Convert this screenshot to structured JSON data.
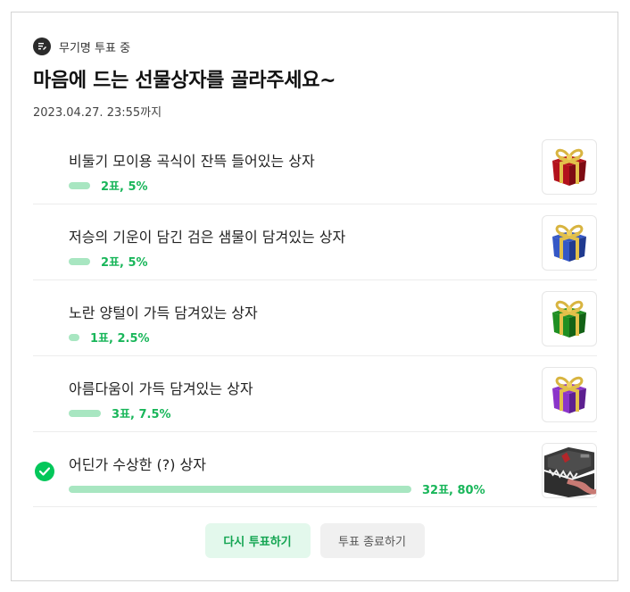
{
  "header": {
    "status": "무기명 투표 중",
    "title": "마음에 드는 선물상자를 골라주세요~",
    "deadline": "2023.04.27. 23:55까지"
  },
  "options": [
    {
      "label": "비둘기 모이용 곡식이 잔뜩 들어있는 상자",
      "count": "2표, 5%",
      "percent": 5,
      "selected": false,
      "icon": "red-gift-box"
    },
    {
      "label": "저승의 기운이 담긴 검은 샘물이 담겨있는 상자",
      "count": "2표, 5%",
      "percent": 5,
      "selected": false,
      "icon": "blue-gift-box"
    },
    {
      "label": "노란 양털이 가득 담겨있는 상자",
      "count": "1표, 2.5%",
      "percent": 2.5,
      "selected": false,
      "icon": "green-gift-box"
    },
    {
      "label": "아름다움이 가득 담겨있는 상자",
      "count": "3표, 7.5%",
      "percent": 7.5,
      "selected": false,
      "icon": "purple-gift-box"
    },
    {
      "label": "어딘가 수상한 (?) 상자",
      "count": "32표, 80%",
      "percent": 80,
      "selected": true,
      "icon": "mimic-chest"
    }
  ],
  "buttons": {
    "revote": "다시 투표하기",
    "end": "투표 종료하기"
  },
  "colors": {
    "accent": "#03c75a",
    "bar": "#a8e6c1",
    "count_text": "#19b65a"
  }
}
